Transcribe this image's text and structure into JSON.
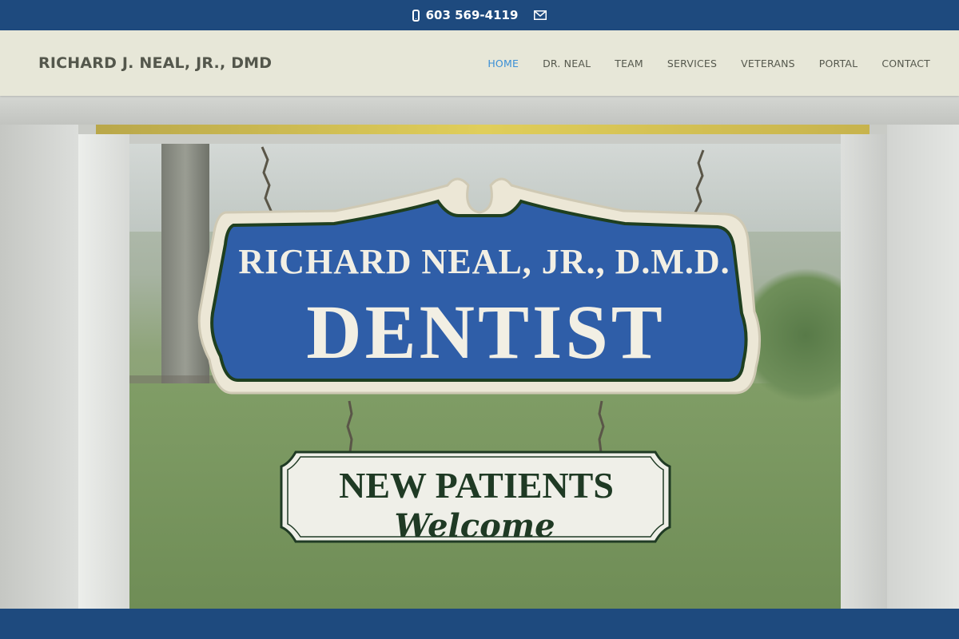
{
  "topbar": {
    "phone": "603 569-4119",
    "phone_icon": "mobile-phone-icon",
    "email_icon": "envelope-icon"
  },
  "header": {
    "brand": "RICHARD J. NEAL, JR., DMD",
    "nav": [
      {
        "label": "HOME",
        "active": true
      },
      {
        "label": "DR. NEAL",
        "active": false
      },
      {
        "label": "TEAM",
        "active": false
      },
      {
        "label": "SERVICES",
        "active": false
      },
      {
        "label": "VETERANS",
        "active": false
      },
      {
        "label": "PORTAL",
        "active": false
      },
      {
        "label": "CONTACT",
        "active": false
      }
    ]
  },
  "hero": {
    "sign_line1": "RICHARD NEAL, JR., D.M.D.",
    "sign_line2": "DENTIST",
    "sub_line1": "NEW PATIENTS",
    "sub_line2": "Welcome"
  },
  "colors": {
    "bar_blue": "#1e4a7e",
    "header_bg": "#e7e7d8",
    "nav_active": "#3a8fd6",
    "nav_text": "#55584d",
    "sign_blue": "#2f5ea8",
    "sign_green_text": "#1f3a24"
  }
}
